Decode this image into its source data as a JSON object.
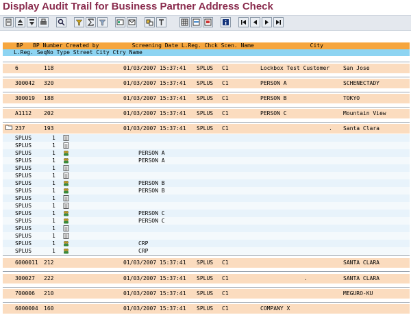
{
  "title": "Display Audit Trail for Business Partner Address Check",
  "toolbar": {
    "icons": [
      "details-icon",
      "sort-ascending-icon",
      "sort-descending-icon",
      "print-icon",
      "find-icon",
      "filter-icon",
      "total-icon",
      "subtotal-icon",
      "export-icon",
      "mail-icon",
      "graphic-icon",
      "abc-icon",
      "layout-icon",
      "select-layout-icon",
      "save-layout-icon",
      "info-icon",
      "first-page-icon",
      "previous-page-icon",
      "next-page-icon",
      "last-page-icon"
    ]
  },
  "header": {
    "line1": "BP   BP Number Created by          Screening Date L.Reg. Chck Scen. Name                 City",
    "line2": "L.Reg. SeqNo Type Street City Ctry Name"
  },
  "rows_top": [
    {
      "bp": "6",
      "num": "118",
      "date": "01/03/2007 15:37:41",
      "lreg": "SPLUS",
      "scen": "C1",
      "name": "Lockbox Test Customer",
      "city": "San Jose"
    },
    {
      "bp": "300042",
      "num": "320",
      "date": "01/03/2007 15:37:41",
      "lreg": "SPLUS",
      "scen": "C1",
      "name": "PERSON A",
      "city": "SCHENECTADY"
    },
    {
      "bp": "300019",
      "num": "188",
      "date": "01/03/2007 15:37:41",
      "lreg": "SPLUS",
      "scen": "C1",
      "name": "PERSON B",
      "city": "TOKYO"
    },
    {
      "bp": "A1112",
      "num": "202",
      "date": "01/03/2007 15:37:41",
      "lreg": "SPLUS",
      "scen": "C1",
      "name": "PERSON C",
      "city": "Mountain View"
    },
    {
      "bp": "237",
      "num": "193",
      "date": "01/03/2007 15:37:41",
      "lreg": "SPLUS",
      "scen": "C1",
      "name": ".",
      "city": "Santa Clara"
    }
  ],
  "subrows": [
    {
      "lreg": "SPLUS",
      "seq": "1",
      "type": "doc",
      "name": ""
    },
    {
      "lreg": "SPLUS",
      "seq": "1",
      "type": "doc",
      "name": ""
    },
    {
      "lreg": "SPLUS",
      "seq": "1",
      "type": "person",
      "name": "PERSON A"
    },
    {
      "lreg": "SPLUS",
      "seq": "1",
      "type": "person",
      "name": "PERSON A"
    },
    {
      "lreg": "SPLUS",
      "seq": "1",
      "type": "doc",
      "name": ""
    },
    {
      "lreg": "SPLUS",
      "seq": "1",
      "type": "doc",
      "name": ""
    },
    {
      "lreg": "SPLUS",
      "seq": "1",
      "type": "person",
      "name": "PERSON B"
    },
    {
      "lreg": "SPLUS",
      "seq": "1",
      "type": "person",
      "name": "PERSON B"
    },
    {
      "lreg": "SPLUS",
      "seq": "1",
      "type": "doc",
      "name": ""
    },
    {
      "lreg": "SPLUS",
      "seq": "1",
      "type": "doc",
      "name": ""
    },
    {
      "lreg": "SPLUS",
      "seq": "1",
      "type": "person",
      "name": "PERSON C"
    },
    {
      "lreg": "SPLUS",
      "seq": "1",
      "type": "person",
      "name": "PERSON C"
    },
    {
      "lreg": "SPLUS",
      "seq": "1",
      "type": "doc",
      "name": ""
    },
    {
      "lreg": "SPLUS",
      "seq": "1",
      "type": "doc",
      "name": ""
    },
    {
      "lreg": "SPLUS",
      "seq": "1",
      "type": "person",
      "name": "CRP"
    },
    {
      "lreg": "SPLUS",
      "seq": "1",
      "type": "person",
      "name": "CRP"
    }
  ],
  "rows_bottom": [
    {
      "bp": "6000011",
      "num": "212",
      "date": "01/03/2007 15:37:41",
      "lreg": "SPLUS",
      "scen": "C1",
      "name": "",
      "city": "SANTA CLARA"
    },
    {
      "bp": "300027",
      "num": "222",
      "date": "01/03/2007 15:37:41",
      "lreg": "SPLUS",
      "scen": "C1",
      "name": ".",
      "city": "SANTA CLARA"
    },
    {
      "bp": "700006",
      "num": "210",
      "date": "01/03/2007 15:37:41",
      "lreg": "SPLUS",
      "scen": "C1",
      "name": "",
      "city": "MEGURO-KU"
    },
    {
      "bp": "6000004",
      "num": "160",
      "date": "01/03/2007 15:37:41",
      "lreg": "SPLUS",
      "scen": "C1",
      "name": "COMPANY X",
      "city": ""
    }
  ]
}
